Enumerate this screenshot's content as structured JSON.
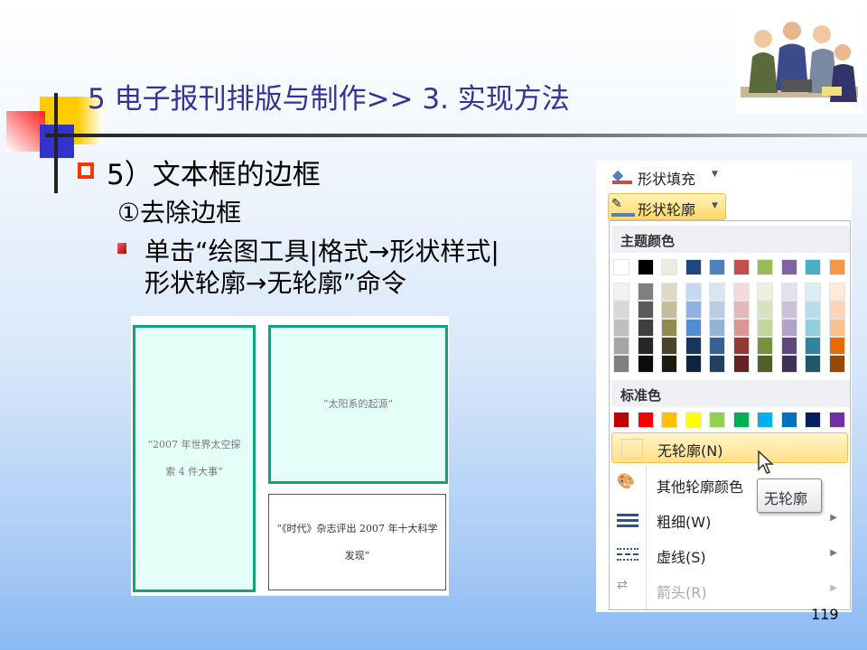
{
  "slide": {
    "title": "5 电子报刊排版与制作>> 3. 实现方法",
    "heading": "5）文本框的边框",
    "subheading": "①去除边框",
    "para_line1": "单击“绘图工具|格式→形状样式|",
    "para_line2": "形状轮廓→无轮廓”命令",
    "page_number": "119"
  },
  "example_image": {
    "box1": "“2007 年世界太空探索 4 件大事”",
    "box2": "“太阳系的起源”",
    "box3": "“《时代》杂志评出 2007 年十大科学发现”",
    "border_color": "#0aa57a",
    "fill_color": "#e4fff7"
  },
  "ribbon": {
    "shape_fill": "形状填充",
    "shape_outline": "形状轮廓"
  },
  "dropdown": {
    "theme_colors_label": "主题颜色",
    "standard_colors_label": "标准色",
    "theme_colors": [
      "#ffffff",
      "#000000",
      "#eeece1",
      "#1f497d",
      "#4f81bd",
      "#c0504d",
      "#9bbb59",
      "#8064a2",
      "#4bacc6",
      "#f79646"
    ],
    "theme_shades": [
      [
        "#f2f2f2",
        "#d8d8d8",
        "#bfbfbf",
        "#a5a5a5",
        "#7f7f7f"
      ],
      [
        "#7f7f7f",
        "#595959",
        "#3f3f3f",
        "#262626",
        "#0c0c0c"
      ],
      [
        "#ddd9c3",
        "#c4bd97",
        "#938953",
        "#494429",
        "#1d1b10"
      ],
      [
        "#c6d9f0",
        "#8db3e2",
        "#548dd4",
        "#17365d",
        "#0f243e"
      ],
      [
        "#dbe5f1",
        "#b8cce4",
        "#95b3d7",
        "#366092",
        "#244061"
      ],
      [
        "#f2dcdb",
        "#e5b9b7",
        "#d99694",
        "#953734",
        "#632423"
      ],
      [
        "#ebf1dd",
        "#d7e3bc",
        "#c3d69b",
        "#76923c",
        "#4f6128"
      ],
      [
        "#e5e0ec",
        "#ccc1d9",
        "#b2a2c7",
        "#5f497a",
        "#3f3151"
      ],
      [
        "#dbeef3",
        "#b7dde8",
        "#92cddc",
        "#31859b",
        "#205867"
      ],
      [
        "#fdeada",
        "#fbd5b5",
        "#fac08f",
        "#e36c09",
        "#974806"
      ]
    ],
    "standard_colors": [
      "#c00000",
      "#ff0000",
      "#ffc000",
      "#ffff00",
      "#92d050",
      "#00b050",
      "#00b0f0",
      "#0070c0",
      "#002060",
      "#7030a0"
    ],
    "items": [
      {
        "label": "无轮廓(N)"
      },
      {
        "label": "其他轮廓颜色"
      },
      {
        "label": "粗细(W)"
      },
      {
        "label": "虚线(S)"
      },
      {
        "label": "箭头(R)"
      }
    ]
  },
  "tooltip": "无轮廓"
}
